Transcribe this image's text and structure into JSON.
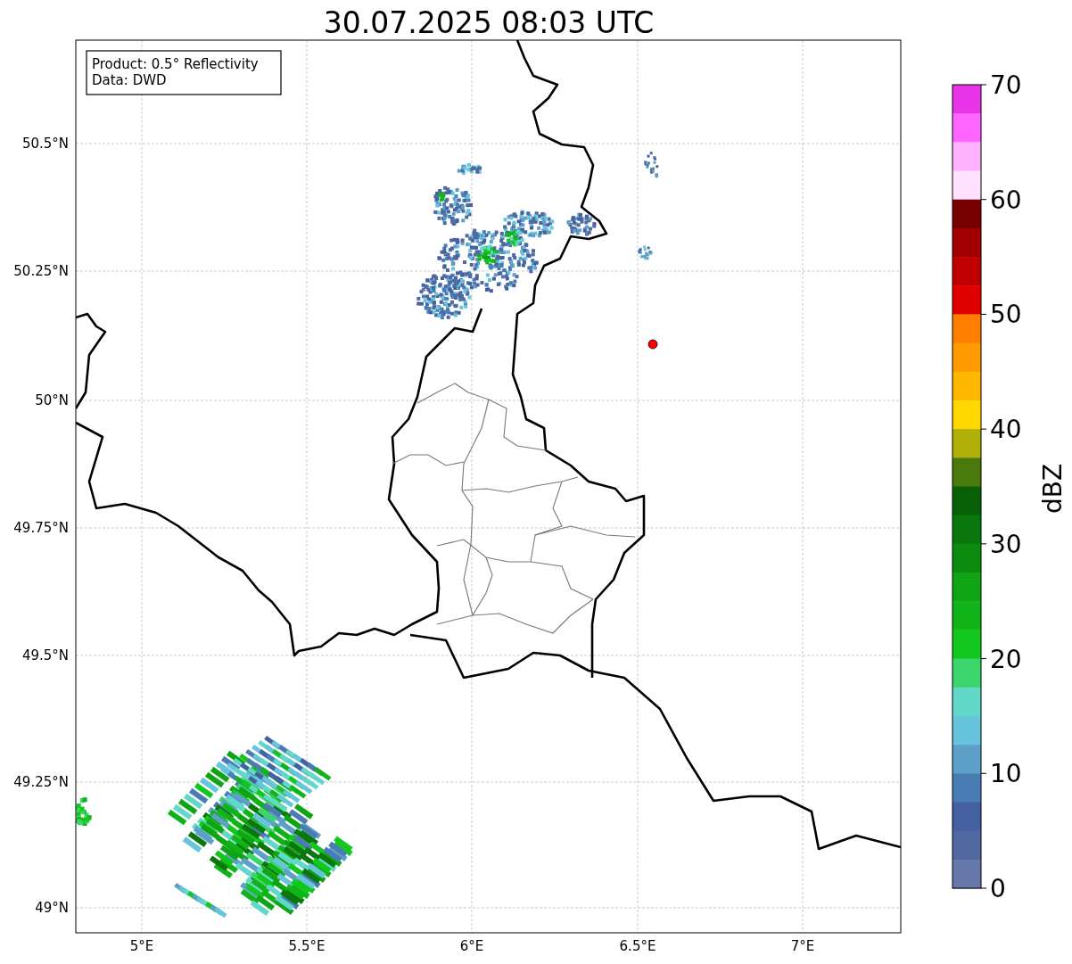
{
  "title": "30.07.2025 08:03 UTC",
  "info_box": {
    "lines": [
      "Product: 0.5° Reflectivity",
      "Data: DWD"
    ]
  },
  "map": {
    "lat_labels": [
      "50.5°N",
      "50.25°N",
      "50°N",
      "49.75°N",
      "49.5°N",
      "49.25°N",
      "49°N"
    ],
    "lon_labels": [
      "5°E",
      "5.5°E",
      "6°E",
      "6.5°E",
      "7°E"
    ]
  },
  "colorbar": {
    "label": "dBZ",
    "ticks": [
      "70",
      "60",
      "50",
      "40",
      "30",
      "20",
      "10",
      "0"
    ],
    "bins": [
      {
        "color": "#e833e8"
      },
      {
        "color": "#ff66ff"
      },
      {
        "color": "#ffb3ff"
      },
      {
        "color": "#ffe0ff"
      },
      {
        "color": "#780000"
      },
      {
        "color": "#a00000"
      },
      {
        "color": "#c00000"
      },
      {
        "color": "#e00000"
      },
      {
        "color": "#ff7e00"
      },
      {
        "color": "#ff9a00"
      },
      {
        "color": "#ffb800"
      },
      {
        "color": "#ffd800"
      },
      {
        "color": "#b0b008"
      },
      {
        "color": "#4a7a0c"
      },
      {
        "color": "#086008"
      },
      {
        "color": "#0a780c"
      },
      {
        "color": "#0c8c0e"
      },
      {
        "color": "#0ea414"
      },
      {
        "color": "#10b418"
      },
      {
        "color": "#12c81e"
      },
      {
        "color": "#3cd46c"
      },
      {
        "color": "#62d8c8"
      },
      {
        "color": "#66c4dc"
      },
      {
        "color": "#5ca0c8"
      },
      {
        "color": "#4a7cb4"
      },
      {
        "color": "#4460a0"
      },
      {
        "color": "#5268a0"
      },
      {
        "color": "#6677aa"
      }
    ]
  }
}
